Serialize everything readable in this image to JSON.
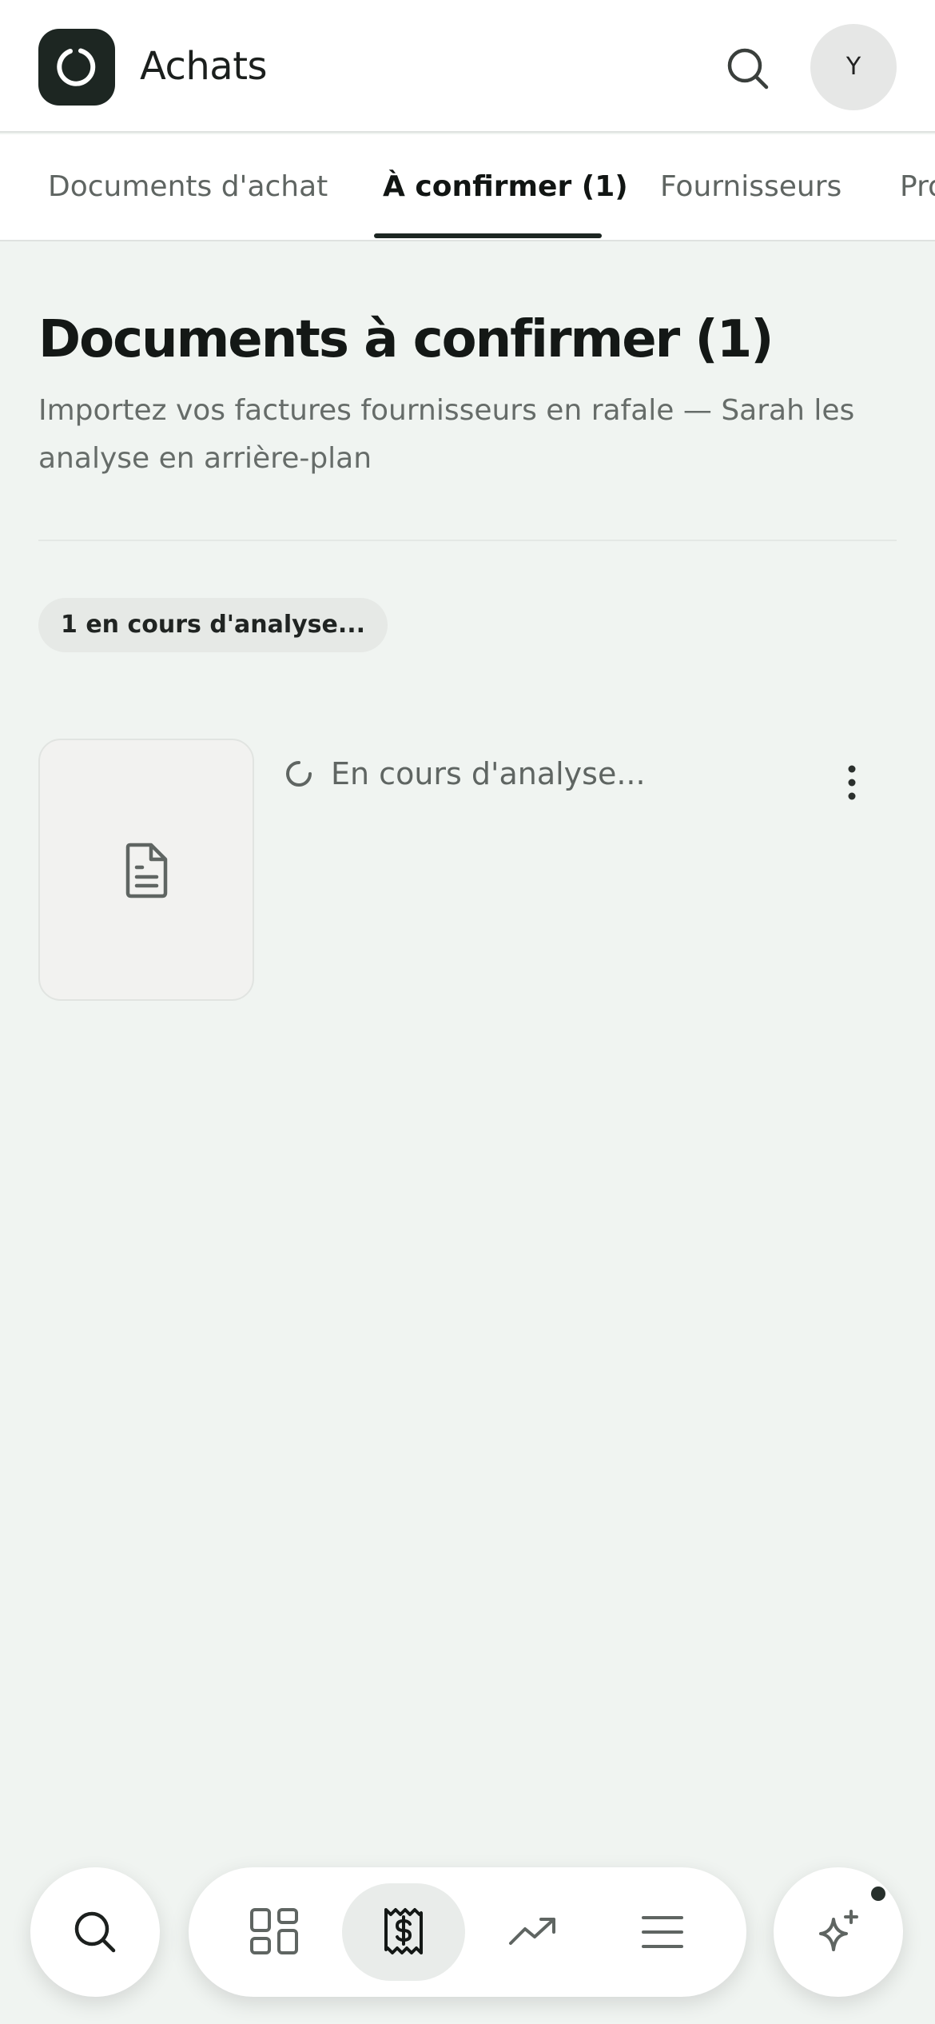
{
  "header": {
    "title": "Achats",
    "avatar_initial": "Y",
    "icons": {
      "logo": "app-logo-icon",
      "search": "search-icon"
    }
  },
  "tabs": [
    {
      "label": "Documents d'achat",
      "active": false
    },
    {
      "label": "À confirmer (1)",
      "active": true
    },
    {
      "label": "Fournisseurs",
      "active": false
    },
    {
      "label": "Pro",
      "active": false
    }
  ],
  "main": {
    "title": "Documents à confirmer (1)",
    "subtitle": "Importez vos factures fournisseurs en rafale — Sarah les analyse en arrière-plan",
    "status_chip": "1 en cours d'analyse...",
    "documents": [
      {
        "status": "En cours d'analyse...",
        "icon": "file-text-icon"
      }
    ]
  },
  "bottom_nav": {
    "items": [
      {
        "icon": "search-icon",
        "active": false
      },
      {
        "icon": "dashboard-icon",
        "active": false
      },
      {
        "icon": "receipt-dollar-icon",
        "active": true
      },
      {
        "icon": "trending-up-icon",
        "active": false
      },
      {
        "icon": "menu-icon",
        "active": false
      },
      {
        "icon": "sparkles-icon",
        "active": false,
        "notification_dot": true
      }
    ]
  },
  "colors": {
    "background": "#f0f4f1",
    "surface": "#ffffff",
    "accent_dark": "#1d2622",
    "text_muted": "#666c69"
  }
}
